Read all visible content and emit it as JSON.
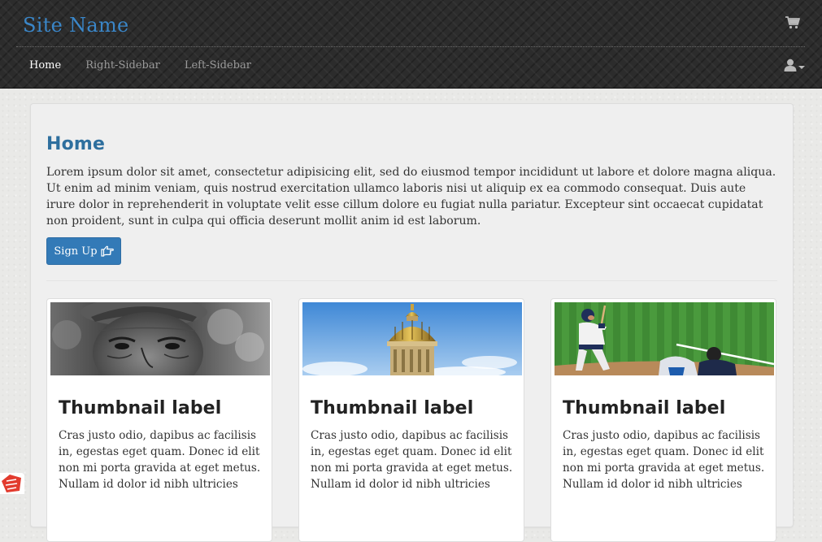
{
  "navbar": {
    "brand": "Site Name",
    "items": [
      {
        "label": "Home",
        "active": true
      },
      {
        "label": "Right-Sidebar",
        "active": false
      },
      {
        "label": "Left-Sidebar",
        "active": false
      }
    ],
    "icons": [
      "shopping-cart-icon",
      "user-icon",
      "caret-down-icon"
    ]
  },
  "jumbotron": {
    "title": "Home",
    "text": "Lorem ipsum dolor sit amet, consectetur adipisicing elit, sed do eiusmod tempor incididunt ut labore et dolore magna aliqua. Ut enim ad minim veniam, quis nostrud exercitation ullamco laboris nisi ut aliquip ex ea commodo consequat. Duis aute irure dolor in reprehenderit in voluptate velit esse cillum dolore eu fugiat nulla pariatur. Excepteur sint occaecat cupidatat non proident, sunt in culpa qui officia deserunt mollit anim id est laborum.",
    "button_label": "Sign Up",
    "button_icon": "hand-pointing-right-icon"
  },
  "thumbnails": [
    {
      "image": "old-man-portrait-photo",
      "label": "Thumbnail label",
      "text": "Cras justo odio, dapibus ac facilisis in, egestas eget quam. Donec id elit non mi porta gravida at eget metus. Nullam id dolor id nibh ultricies"
    },
    {
      "image": "golden-dome-building-photo",
      "label": "Thumbnail label",
      "text": "Cras justo odio, dapibus ac facilisis in, egestas eget quam. Donec id elit non mi porta gravida at eget metus. Nullam id dolor id nibh ultricies"
    },
    {
      "image": "baseball-batter-photo",
      "label": "Thumbnail label",
      "text": "Cras justo odio, dapibus ac facilisis in, egestas eget quam. Donec id elit non mi porta gravida at eget metus. Nullam id dolor id nibh ultricies"
    }
  ],
  "colors": {
    "brand": "#3a86c8",
    "title": "#2e6f9e",
    "button": "#337ab7",
    "navbar_bg": "#2c2c2c"
  }
}
